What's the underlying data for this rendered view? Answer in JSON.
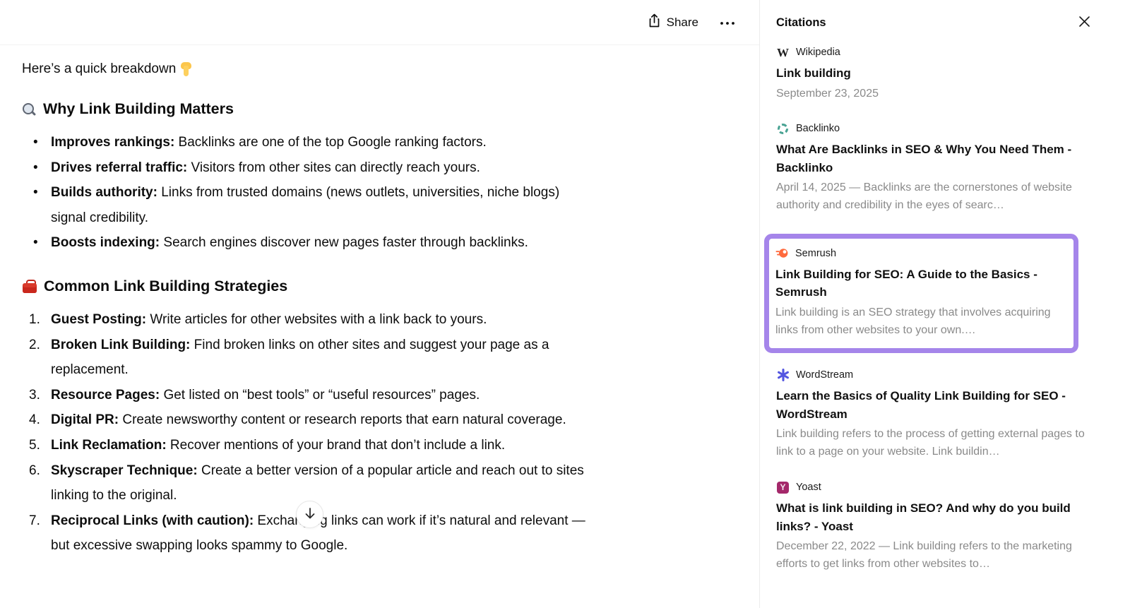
{
  "topbar": {
    "share_label": "Share",
    "icons": {
      "share": "share-up-arrow",
      "more": "ellipsis"
    }
  },
  "content": {
    "intro_text": "Here’s a quick breakdown",
    "intro_emoji": "👇 (backhand-index-pointing-down)",
    "sections": [
      {
        "emoji": "🔍 (magnifying-glass)",
        "title": "Why Link Building Matters",
        "items": [
          {
            "label": "Improves rankings:",
            "text": " Backlinks are one of the top Google ranking factors."
          },
          {
            "label": "Drives referral traffic:",
            "text": " Visitors from other sites can directly reach yours."
          },
          {
            "label": "Builds authority:",
            "text": " Links from trusted domains (news outlets, universities, niche blogs) signal credibility."
          },
          {
            "label": "Boosts indexing:",
            "text": " Search engines discover new pages faster through backlinks."
          }
        ]
      },
      {
        "emoji": "🧰 (toolbox)",
        "title": "Common Link Building Strategies",
        "items": [
          {
            "label": "Guest Posting:",
            "text": " Write articles for other websites with a link back to yours."
          },
          {
            "label": "Broken Link Building:",
            "text": " Find broken links on other sites and suggest your page as a replacement."
          },
          {
            "label": "Resource Pages:",
            "text": " Get listed on “best tools” or “useful resources” pages."
          },
          {
            "label": "Digital PR:",
            "text": " Create newsworthy content or research reports that earn natural coverage."
          },
          {
            "label": "Link Reclamation:",
            "text": " Recover mentions of your brand that don’t include a link."
          },
          {
            "label": "Skyscraper Technique:",
            "text": " Create a better version of a popular article and reach out to sites linking to the original."
          },
          {
            "label": "Reciprocal Links (with caution):",
            "text": " Exchanging links can work if it’s natural and relevant — but excessive swapping looks spammy to Google."
          }
        ]
      }
    ]
  },
  "citations": {
    "title": "Citations",
    "entries": [
      {
        "source": "Wikipedia",
        "icon": "wikipedia-w-logo",
        "icon_glyph": "W",
        "title": "Link building",
        "snippet": "September 23, 2025",
        "highlighted": false
      },
      {
        "source": "Backlinko",
        "icon": "backlinko-dashed-circle-logo",
        "title": "What Are Backlinks in SEO & Why You Need Them - Backlinko",
        "snippet": "April 14, 2025 — Backlinks are the cornerstones of website authority and credibility in the eyes of searc…",
        "highlighted": false
      },
      {
        "source": "Semrush",
        "icon": "semrush-comet-logo",
        "title": "Link Building for SEO: A Guide to the Basics - Semrush",
        "snippet": "Link building is an SEO strategy that involves acquiring links from other websites to your own.…",
        "highlighted": true
      },
      {
        "source": "WordStream",
        "icon": "wordstream-asterisk-logo",
        "title": "Learn the Basics of Quality Link Building for SEO - WordStream",
        "snippet": "Link building refers to the process of getting external pages to link to a page on your website. Link buildin…",
        "highlighted": false
      },
      {
        "source": "Yoast",
        "icon": "yoast-y-logo",
        "icon_glyph": "Y",
        "title": "What is link building in SEO? And why do you build links? - Yoast",
        "snippet": "December 22, 2022 — Link building refers to the marketing efforts to get links from other websites to…",
        "highlighted": false
      }
    ]
  },
  "colors": {
    "highlight_border": "#a585ea",
    "semrush_orange": "#ff642d",
    "backlinko_teal": "#49a393",
    "wordstream_blue": "#5456e0",
    "yoast_purple": "#a4286a",
    "snippet_gray": "#8a8a8a"
  }
}
